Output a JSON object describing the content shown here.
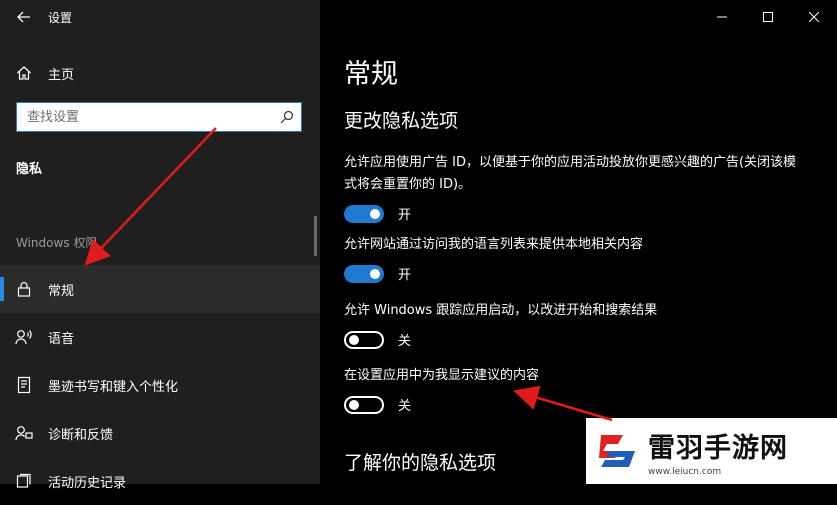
{
  "window": {
    "title": "设置"
  },
  "sidebar": {
    "home_label": "主页",
    "search_placeholder": "查找设置",
    "section_title": "隐私",
    "group_label": "Windows 权限",
    "items": [
      {
        "label": "常规",
        "icon": "lock-icon",
        "active": true
      },
      {
        "label": "语音",
        "icon": "speech-icon"
      },
      {
        "label": "墨迹书写和键入个性化",
        "icon": "ink-typing-icon"
      },
      {
        "label": "诊断和反馈",
        "icon": "feedback-icon"
      },
      {
        "label": "活动历史记录",
        "icon": "history-icon"
      }
    ]
  },
  "main": {
    "page_title": "常规",
    "section_title": "更改隐私选项",
    "settings": [
      {
        "desc": "允许应用使用广告 ID，以便基于你的应用活动投放你更感兴趣的广告(关闭该模式将会重置你的 ID)。",
        "state": "开",
        "on": true
      },
      {
        "desc": "允许网站通过访问我的语言列表来提供本地相关内容",
        "state": "开",
        "on": true
      },
      {
        "desc": "允许 Windows 跟踪应用启动，以改进开始和搜索结果",
        "state": "关",
        "on": false
      },
      {
        "desc": "在设置应用中为我显示建议的内容",
        "state": "关",
        "on": false
      }
    ],
    "learn_title": "了解你的隐私选项"
  },
  "watermark": {
    "name": "雷羽手游网",
    "url": "www.leiucn.com"
  },
  "colors": {
    "accent": "#1f7ad0",
    "arrow": "#e01b1b",
    "sidebar_bg": "#1f1f1f"
  }
}
